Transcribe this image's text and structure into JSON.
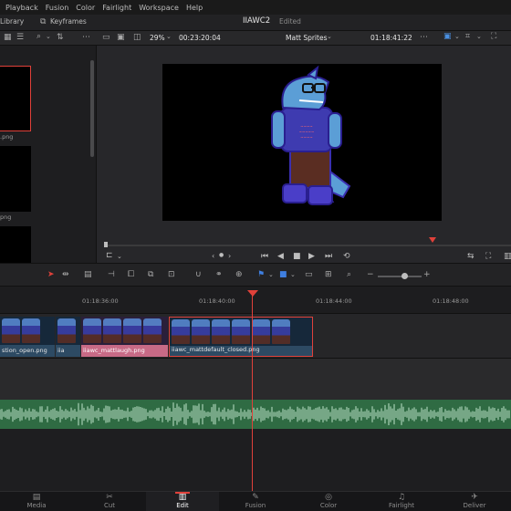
{
  "menu": [
    "Playback",
    "Fusion",
    "Color",
    "Fairlight",
    "Workspace",
    "Help"
  ],
  "toolbar": {
    "library_label": "Library",
    "keyframes_label": "Keyframes",
    "project_title": "IIAWC2",
    "project_status": "Edited"
  },
  "viewer_bar": {
    "zoom": "29%",
    "source_timecode": "00:23:20:04",
    "clip_name": "Matt Sprites",
    "record_timecode": "01:18:41:22"
  },
  "media_pool": {
    "items": [
      {
        "label": ".png"
      },
      {
        "label": "png"
      },
      {
        "label": ""
      }
    ]
  },
  "ruler": {
    "timecodes": [
      "01:18:36:00",
      "01:18:40:00",
      "01:18:44:00",
      "01:18:48:00"
    ]
  },
  "clips": [
    {
      "label": "stion_open.png"
    },
    {
      "label": "iia"
    },
    {
      "label": "iiawc_mattlaugh.png"
    },
    {
      "label": "iiawc_mattdefault_closed.png"
    }
  ],
  "pages": [
    {
      "label": "Media",
      "icon": "media-icon"
    },
    {
      "label": "Cut",
      "icon": "cut-icon"
    },
    {
      "label": "Edit",
      "icon": "edit-icon",
      "active": true
    },
    {
      "label": "Fusion",
      "icon": "fusion-icon"
    },
    {
      "label": "Color",
      "icon": "color-icon"
    },
    {
      "label": "Fairlight",
      "icon": "fairlight-icon"
    },
    {
      "label": "Deliver",
      "icon": "deliver-icon"
    }
  ],
  "colors": {
    "accent": "#e0413a",
    "video_clip": "#2d4a63",
    "pink_clip": "#c86a86",
    "audio_track": "#2f6b43"
  }
}
